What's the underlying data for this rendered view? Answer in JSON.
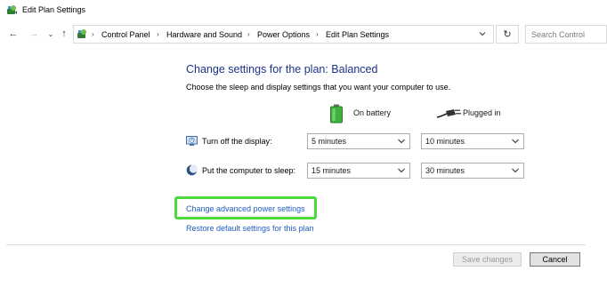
{
  "window": {
    "title": "Edit Plan Settings"
  },
  "nav": {
    "breadcrumb": [
      "Control Panel",
      "Hardware and Sound",
      "Power Options",
      "Edit Plan Settings"
    ],
    "search_placeholder": "Search Control"
  },
  "main": {
    "heading": "Change settings for the plan: Balanced",
    "subheading": "Choose the sleep and display settings that you want your computer to use.",
    "columns": {
      "battery": "On battery",
      "plugged": "Plugged in"
    },
    "rows": [
      {
        "label": "Turn off the display:",
        "battery_value": "5 minutes",
        "plugged_value": "10 minutes"
      },
      {
        "label": "Put the computer to sleep:",
        "battery_value": "15 minutes",
        "plugged_value": "30 minutes"
      }
    ],
    "links": {
      "advanced": "Change advanced power settings",
      "restore": "Restore default settings for this plan"
    }
  },
  "footer": {
    "save_label": "Save changes",
    "cancel_label": "Cancel"
  },
  "colors": {
    "heading": "#1e3287",
    "link": "#1e5cc8",
    "highlight": "#4cdb3c"
  }
}
